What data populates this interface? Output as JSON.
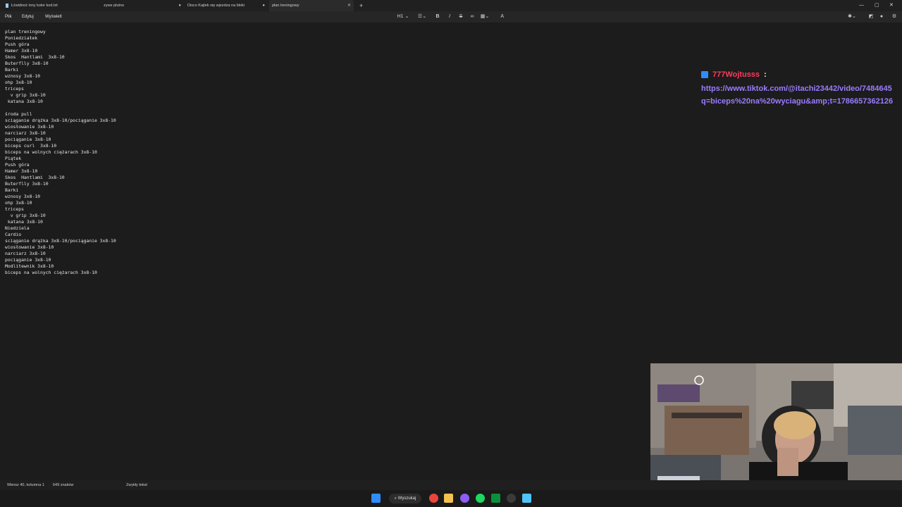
{
  "tabs": [
    {
      "label": "Łżwidnoż inny kolor  kod.txt"
    },
    {
      "label": "zywe plutno"
    },
    {
      "label": "Disco Kajtek się wjezdza na bloki"
    },
    {
      "label": "plan treningowy"
    }
  ],
  "menu": {
    "file": "Plik",
    "edit": "Edytuj",
    "view": "Wyświetl"
  },
  "toolbar": {
    "heading": "H1"
  },
  "document_lines": [
    "plan treningowy",
    "Poniedziałek",
    "Push góra",
    "Hamer 3x8-10",
    "Skos  Hantlami  3x8-10",
    "Buterflly 3x8-10",
    "Barki",
    "wznosy 3x8-10",
    "ohp 3x8-10",
    "triceps",
    "  v grip 3x8-10",
    " katana 3x8-10",
    "",
    "środa pull",
    "sciąganie drążka 3x8-10/pociąganie 3x8-10",
    "wiosłowanie 3x8-10",
    "narciarz 3x8-10",
    "pociąganie 3x8-10",
    "biceps curl  3x8-10",
    "biceps na wolnych ciężarach 3x8-10",
    "Piątek",
    "Push góra",
    "Hamer 3x8-10",
    "Skos  Hantlami  3x8-10",
    "Buterflly 3x8-10",
    "Barki",
    "wznosy 3x8-10",
    "ohp 3x8-10",
    "triceps",
    "  v grip 3x8-10",
    " katana 3x8-10",
    "Niedziela",
    "Cardio",
    "sciąganie drążka 3x8-10/pociąganie 3x8-10",
    "wiosłowanie 3x8-10",
    "narciarz 3x8-10",
    "pociąganie 3x8-10",
    "Modlitewnik 3x8-10",
    "biceps na wolnych ciężarach 3x8-10"
  ],
  "chat": {
    "username": "777Wojtusss",
    "colon": ":",
    "message": "https://www.tiktok.com/@itachi23442/video/7484645\nq=biceps%20na%20wyciagu&amp;t=1786657362126"
  },
  "status": {
    "position": "Wiersz 40, kolumna 1",
    "chars": "649 znaków",
    "format": "Zwykły tekst"
  },
  "taskbar": {
    "search": "Wyszukaj"
  },
  "colors": {
    "chat_user": "#ff3b5c",
    "chat_link": "#9a7cff",
    "background": "#1c1c1c"
  }
}
